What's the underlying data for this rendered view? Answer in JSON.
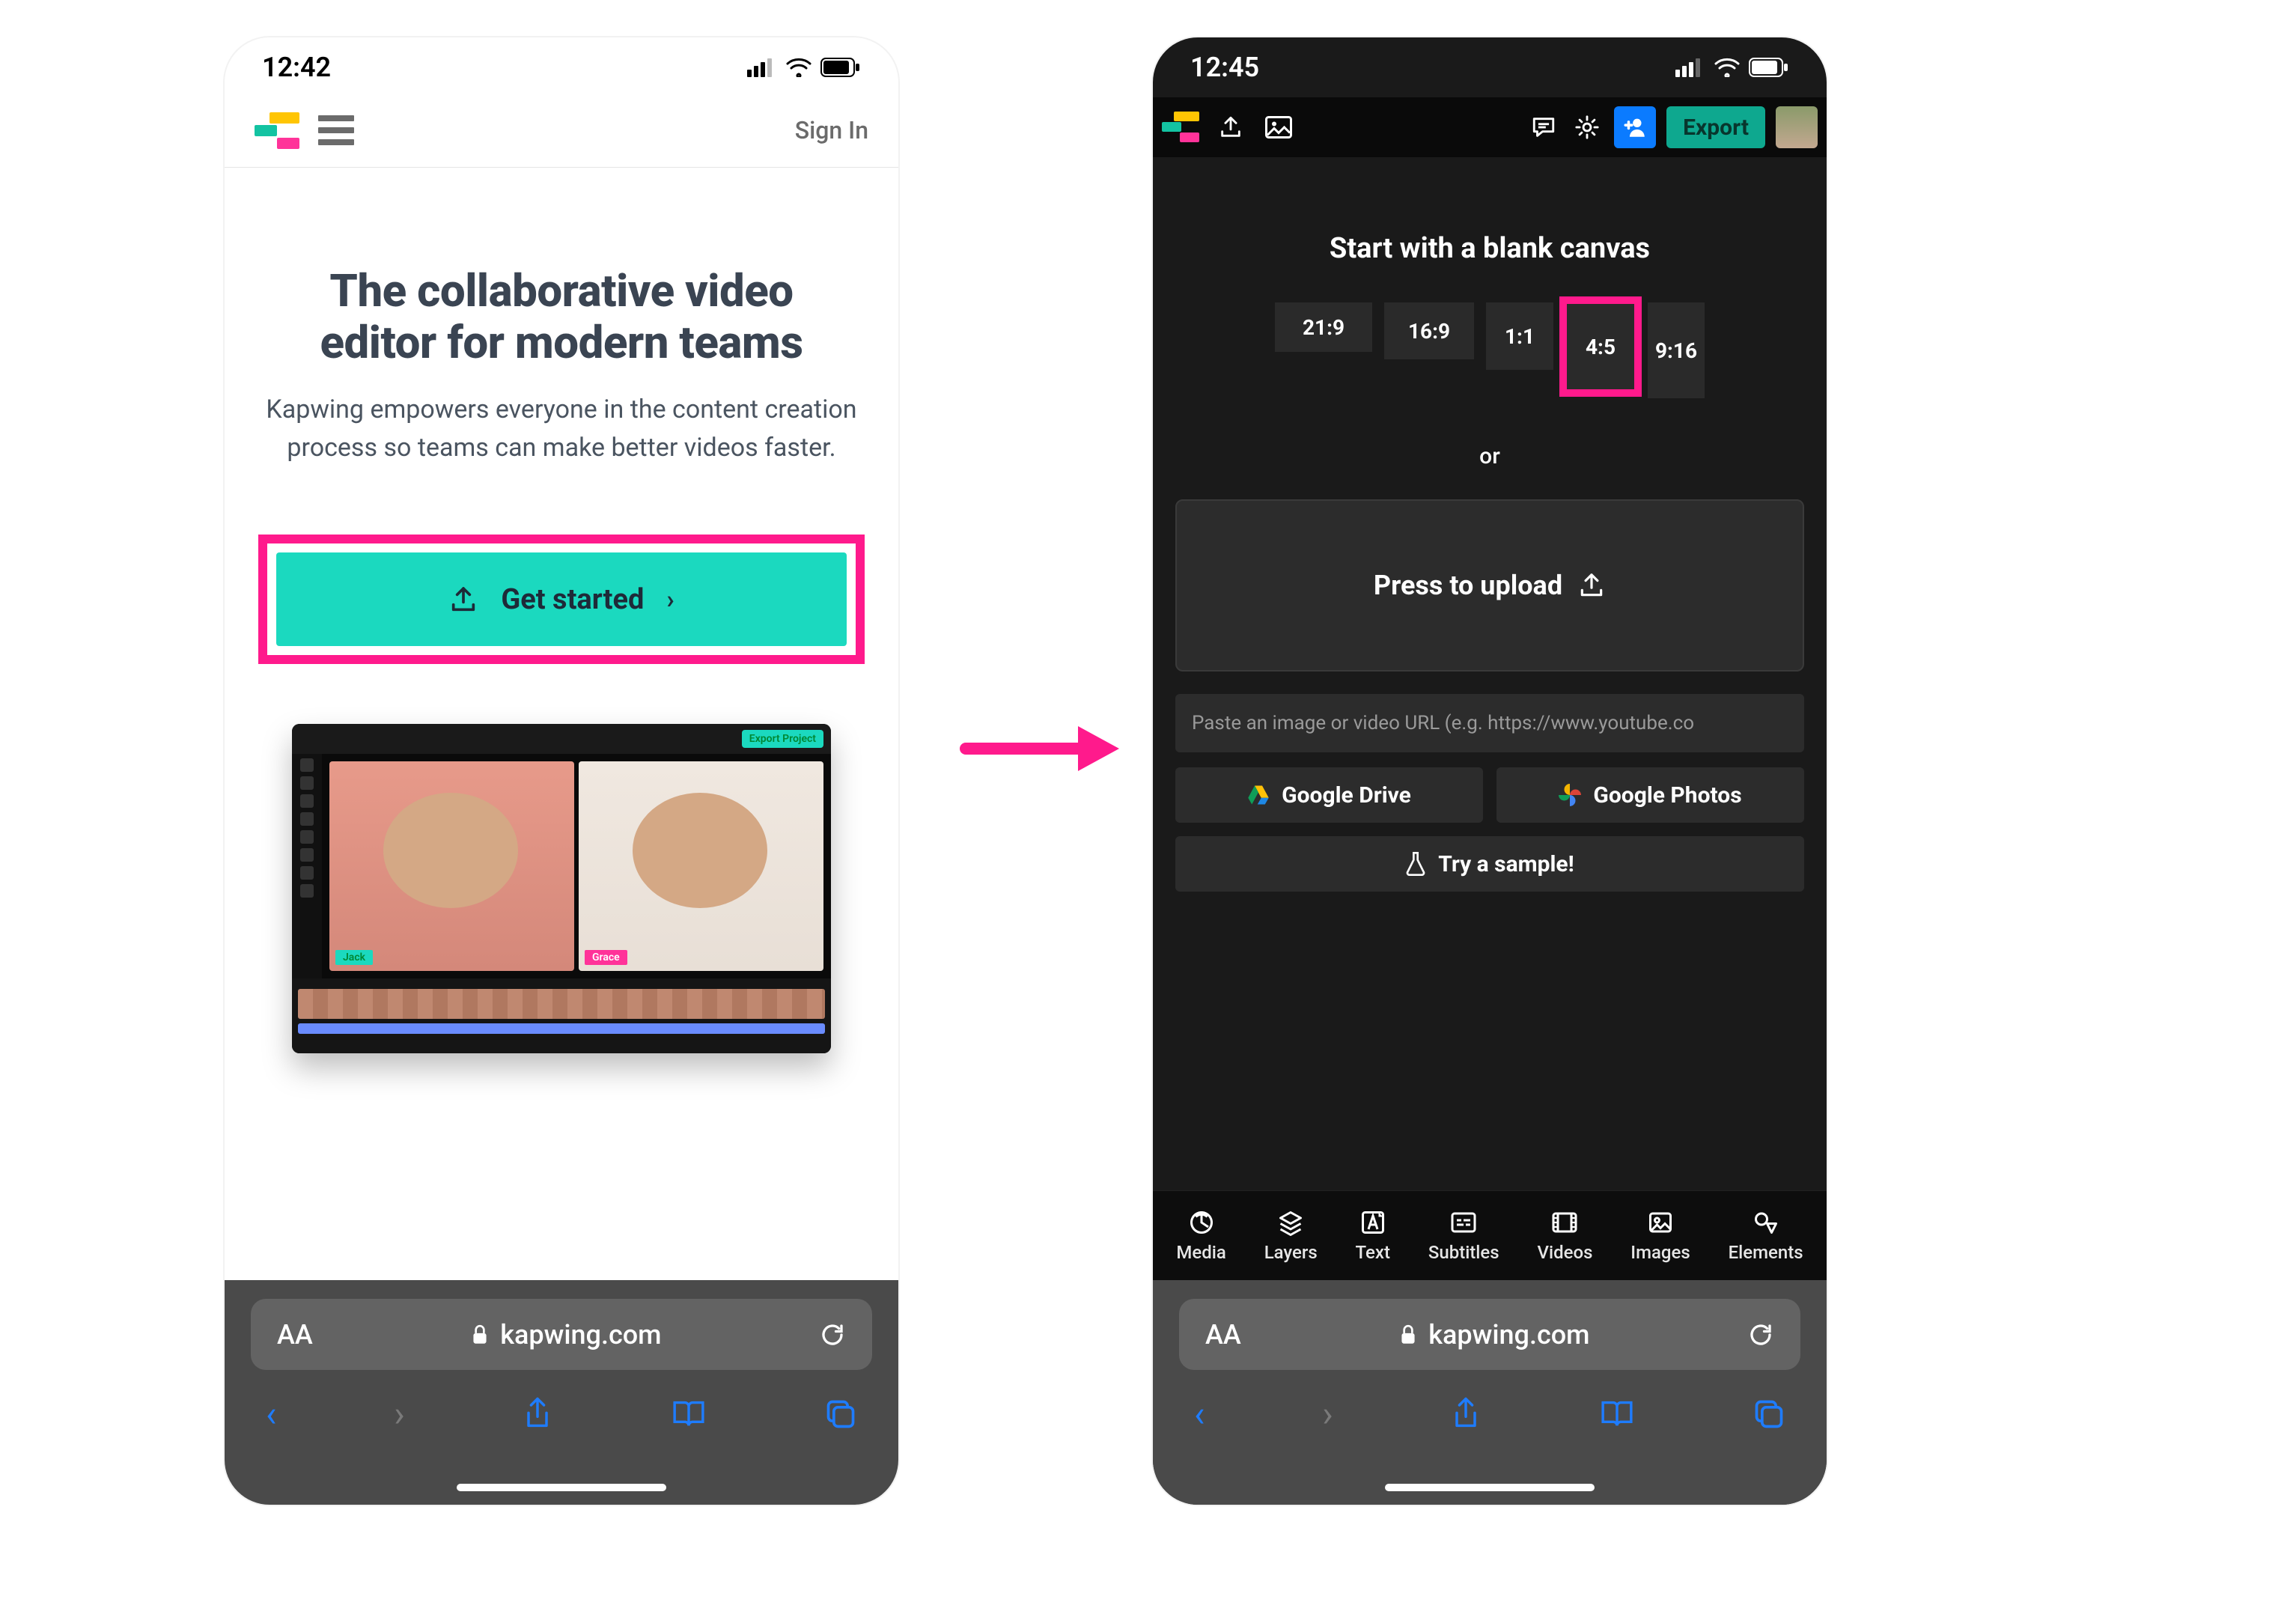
{
  "left": {
    "status_time": "12:42",
    "signin": "Sign In",
    "hero_title_l1": "The collaborative video",
    "hero_title_l2": "editor for modern teams",
    "hero_sub": "Kapwing empowers everyone in the content creation process so teams can make better videos faster.",
    "cta_label": "Get started",
    "preview_name1": "Jack",
    "preview_name2": "Grace",
    "url_domain": "kapwing.com",
    "aa_label": "AA"
  },
  "right": {
    "status_time": "12:45",
    "export_label": "Export",
    "title": "Start with a blank canvas",
    "ratios": [
      "21:9",
      "16:9",
      "1:1",
      "4:5",
      "9:16"
    ],
    "selected_ratio": "4:5",
    "or_label": "or",
    "upload_label": "Press to upload",
    "url_placeholder": "Paste an image or video URL (e.g. https://www.youtube.co",
    "gdrive_label": "Google Drive",
    "gphotos_label": "Google Photos",
    "sample_label": "Try a sample!",
    "tabs": [
      "Media",
      "Layers",
      "Text",
      "Subtitles",
      "Videos",
      "Images",
      "Elements"
    ],
    "url_domain": "kapwing.com",
    "aa_label": "AA"
  },
  "colors": {
    "highlight": "#ff1a8c",
    "accent": "#1bd9bf",
    "export": "#0ea88f",
    "blue": "#0b7bff"
  }
}
